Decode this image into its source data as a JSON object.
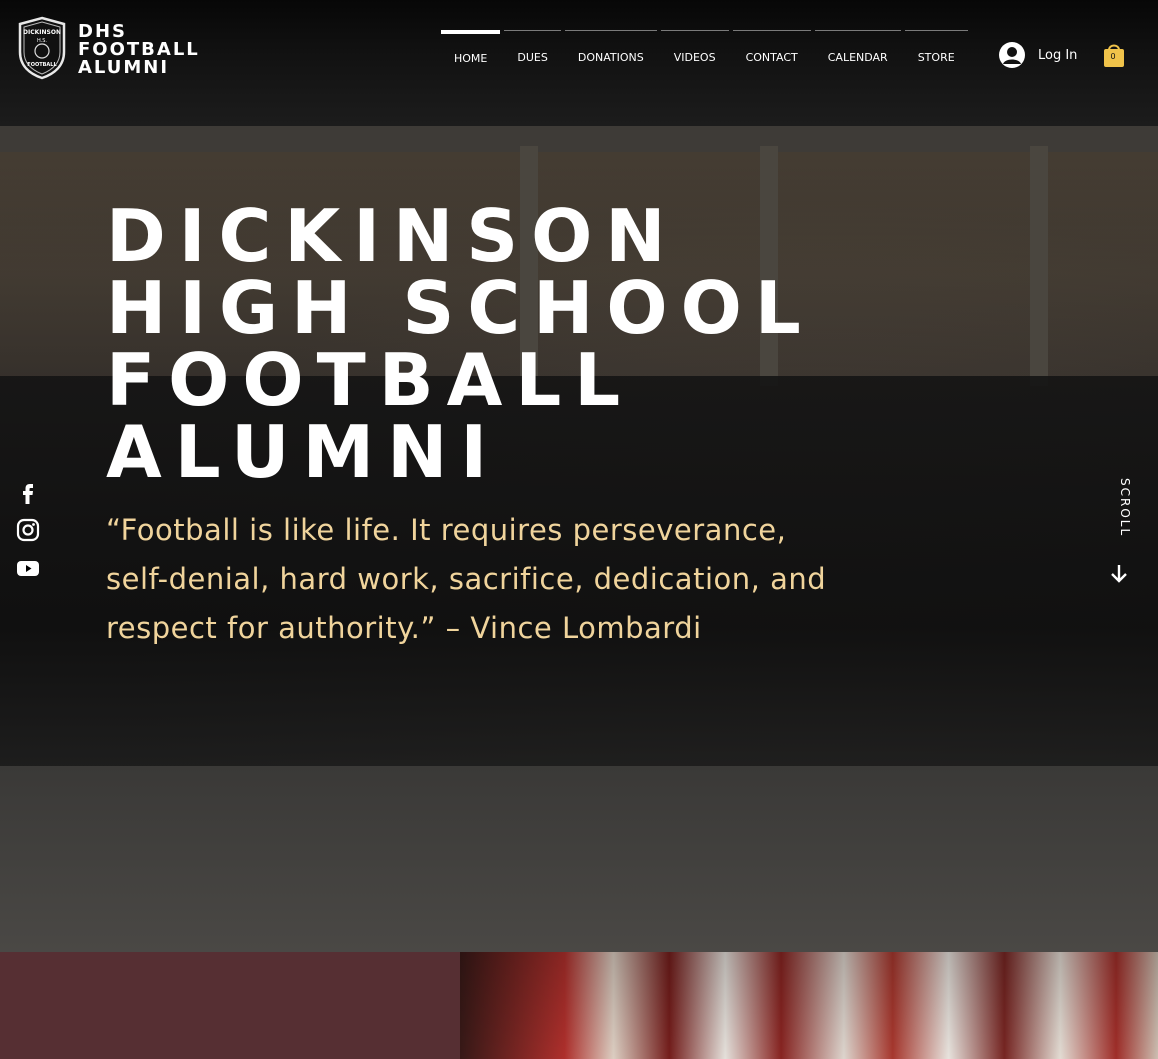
{
  "header": {
    "brand_lines": [
      "DHS",
      "FOOTBALL",
      "ALUMNI"
    ],
    "logo_text": {
      "top": "DICKINSON",
      "middle": "H.S.",
      "bottom": "FOOTBALL"
    },
    "nav": [
      {
        "label": "HOME",
        "active": true
      },
      {
        "label": "DUES",
        "active": false
      },
      {
        "label": "DONATIONS",
        "active": false
      },
      {
        "label": "VIDEOS",
        "active": false
      },
      {
        "label": "CONTACT",
        "active": false
      },
      {
        "label": "CALENDAR",
        "active": false
      },
      {
        "label": "STORE",
        "active": false
      }
    ],
    "login_label": "Log In",
    "cart_count": "0"
  },
  "hero": {
    "title_lines": [
      "DICKINSON",
      "HIGH SCHOOL",
      "FOOTBALL",
      "ALUMNI"
    ],
    "quote": "“Football is like life. It requires perseverance, self-denial, hard work, sacrifice, dedication, and respect for authority.” – Vince Lombardi",
    "scroll_label": "SCROLL"
  },
  "social": [
    {
      "icon": "facebook-icon"
    },
    {
      "icon": "instagram-icon"
    },
    {
      "icon": "youtube-icon"
    }
  ],
  "colors": {
    "header_bg": "#121212",
    "quote_text": "#f0d49c",
    "lower_panel": "#562f33",
    "text_primary": "#ffffff"
  }
}
